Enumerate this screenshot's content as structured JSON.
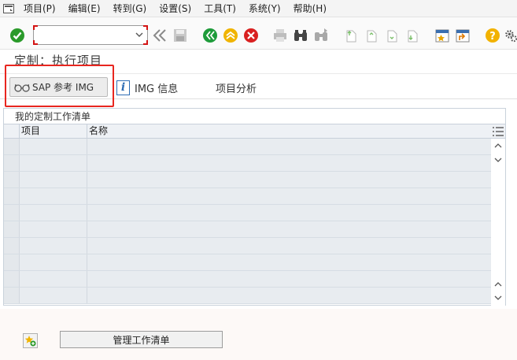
{
  "menubar": {
    "items": [
      "项目(P)",
      "编辑(E)",
      "转到(G)",
      "设置(S)",
      "工具(T)",
      "系统(Y)",
      "帮助(H)"
    ]
  },
  "toolbar": {
    "command_value": "",
    "icons": [
      "enter-icon",
      "command-dropdown-icon",
      "double-left-arrow-icon",
      "save-icon",
      "back-icon",
      "exit-icon",
      "cancel-icon",
      "print-icon",
      "find-icon",
      "find-next-icon",
      "first-page-icon",
      "previous-page-icon",
      "next-page-icon",
      "last-page-icon",
      "create-session-icon",
      "generate-shortcut-icon",
      "help-icon",
      "customize-layout-icon"
    ]
  },
  "page": {
    "title": "定制：执行项目"
  },
  "app_toolbar": {
    "sap_img_label": "SAP 参考 IMG",
    "img_info_label": "IMG 信息",
    "project_analysis_label": "项目分析"
  },
  "worklist": {
    "title": "我的定制工作清单",
    "columns": [
      "项目",
      "名称"
    ],
    "rows": [
      [
        "",
        ""
      ],
      [
        "",
        ""
      ],
      [
        "",
        ""
      ],
      [
        "",
        ""
      ],
      [
        "",
        ""
      ],
      [
        "",
        ""
      ],
      [
        "",
        ""
      ],
      [
        "",
        ""
      ],
      [
        "",
        ""
      ],
      [
        "",
        ""
      ]
    ]
  },
  "bottom": {
    "manage_button_label": "管理工作清单"
  },
  "colors": {
    "highlight": "#e8261f",
    "enter_green": "#2a9a2a",
    "back_green": "#1e9b3a",
    "exit_yellow": "#f0b400",
    "cancel_red": "#d92020",
    "help_yellow": "#f2b200"
  }
}
